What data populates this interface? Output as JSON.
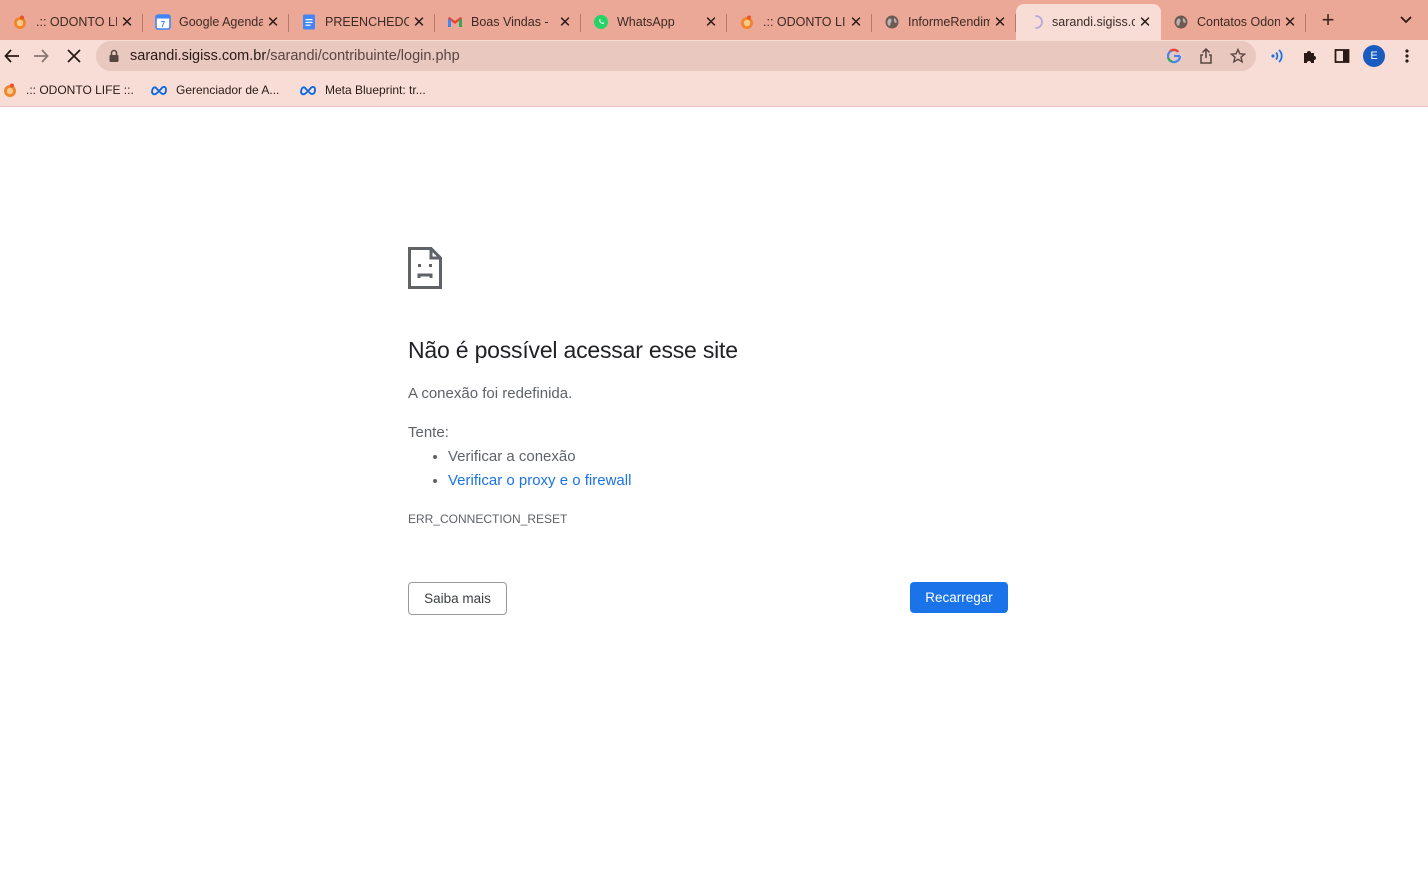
{
  "browser": {
    "tabs": [
      {
        "title": ".:: ODONTO LIFE ::.",
        "icon": "odonto-favicon-icon"
      },
      {
        "title": "Google Agenda",
        "icon": "google-calendar-icon"
      },
      {
        "title": "PREENCHEDOR",
        "icon": "google-docs-icon"
      },
      {
        "title": "Boas Vindas -",
        "icon": "gmail-icon"
      },
      {
        "title": "WhatsApp",
        "icon": "whatsapp-icon"
      },
      {
        "title": ".:: ODONTO LIFE ::.",
        "icon": "odonto-favicon-icon"
      },
      {
        "title": "InformeRendimentos",
        "icon": "globe-icon"
      },
      {
        "title": "sarandi.sigiss.com.br",
        "icon": "loading-spinner-icon",
        "active": true
      },
      {
        "title": "Contatos Odonto",
        "icon": "globe-icon"
      }
    ],
    "new_tab_label": "+",
    "address": {
      "host": "sarandi.sigiss.com.br",
      "path": "/sarandi/contribuinte/login.php"
    },
    "profile_initial": "E",
    "bookmarks": [
      {
        "label": ".:: ODONTO LIFE ::.",
        "icon": "odonto-favicon-icon"
      },
      {
        "label": "Gerenciador de A...",
        "icon": "meta-icon"
      },
      {
        "label": "Meta Blueprint: tr...",
        "icon": "meta-icon"
      }
    ]
  },
  "error_page": {
    "heading": "Não é possível acessar esse site",
    "detail": "A conexão foi redefinida.",
    "try_label": "Tente:",
    "suggestions": [
      "Verificar a conexão",
      "Verificar o proxy e o firewall"
    ],
    "error_code": "ERR_CONNECTION_RESET",
    "learn_more_label": "Saiba mais",
    "reload_label": "Recarregar"
  },
  "colors": {
    "tabstrip": "#eca896",
    "toolbar": "#f8ddd6",
    "reload_button": "#1a73e8",
    "link": "#1a73e8"
  }
}
